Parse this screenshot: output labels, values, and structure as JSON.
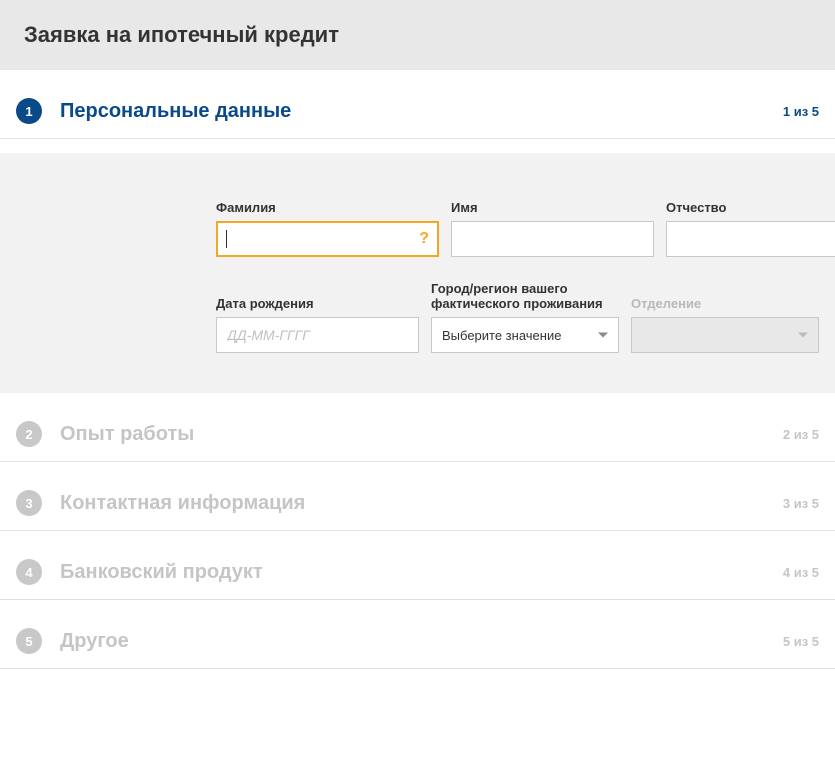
{
  "page": {
    "title": "Заявка на ипотечный кредит"
  },
  "steps": [
    {
      "number": "1",
      "title": "Персональные данные",
      "counter": "1 из 5",
      "active": true
    },
    {
      "number": "2",
      "title": "Опыт работы",
      "counter": "2 из 5",
      "active": false
    },
    {
      "number": "3",
      "title": "Контактная информация",
      "counter": "3 из 5",
      "active": false
    },
    {
      "number": "4",
      "title": "Банковский продукт",
      "counter": "4 из 5",
      "active": false
    },
    {
      "number": "5",
      "title": "Другое",
      "counter": "5 из 5",
      "active": false
    }
  ],
  "form": {
    "surname": {
      "label": "Фамилия",
      "value": "",
      "help": "?"
    },
    "name": {
      "label": "Имя",
      "value": ""
    },
    "patronymic": {
      "label": "Отчество",
      "value": ""
    },
    "birthdate": {
      "label": "Дата рождения",
      "value": "",
      "placeholder": "ДД-ММ-ГГГГ"
    },
    "region": {
      "label": "Город/регион вашего фактического проживания",
      "selected": "Выберите значение"
    },
    "branch": {
      "label": "Отделение",
      "selected": ""
    }
  }
}
